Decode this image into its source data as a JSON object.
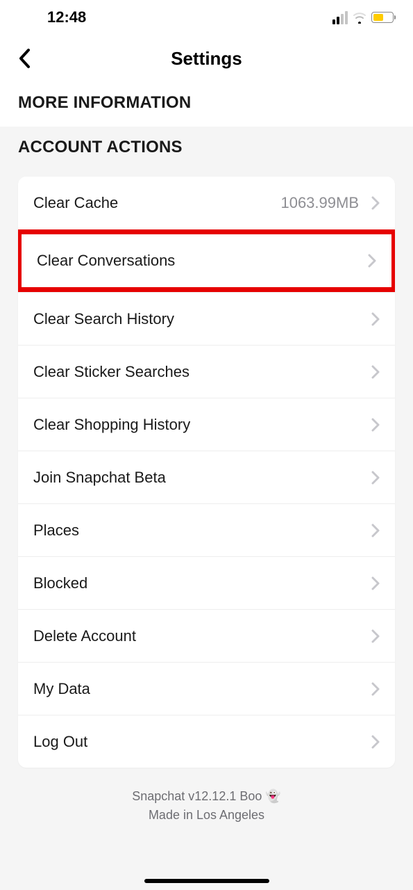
{
  "status": {
    "time": "12:48"
  },
  "header": {
    "title": "Settings"
  },
  "sections": {
    "more_info_header": "MORE INFORMATION",
    "account_actions_header": "ACCOUNT ACTIONS"
  },
  "account_actions": {
    "clear_cache": {
      "label": "Clear Cache",
      "value": "1063.99MB"
    },
    "clear_conversations": {
      "label": "Clear Conversations"
    },
    "clear_search_history": {
      "label": "Clear Search History"
    },
    "clear_sticker_searches": {
      "label": "Clear Sticker Searches"
    },
    "clear_shopping_history": {
      "label": "Clear Shopping History"
    },
    "join_beta": {
      "label": "Join Snapchat Beta"
    },
    "places": {
      "label": "Places"
    },
    "blocked": {
      "label": "Blocked"
    },
    "delete_account": {
      "label": "Delete Account"
    },
    "my_data": {
      "label": "My Data"
    },
    "log_out": {
      "label": "Log Out"
    }
  },
  "footer": {
    "line1": "Snapchat v12.12.1 Boo 👻",
    "line2": "Made in Los Angeles"
  }
}
